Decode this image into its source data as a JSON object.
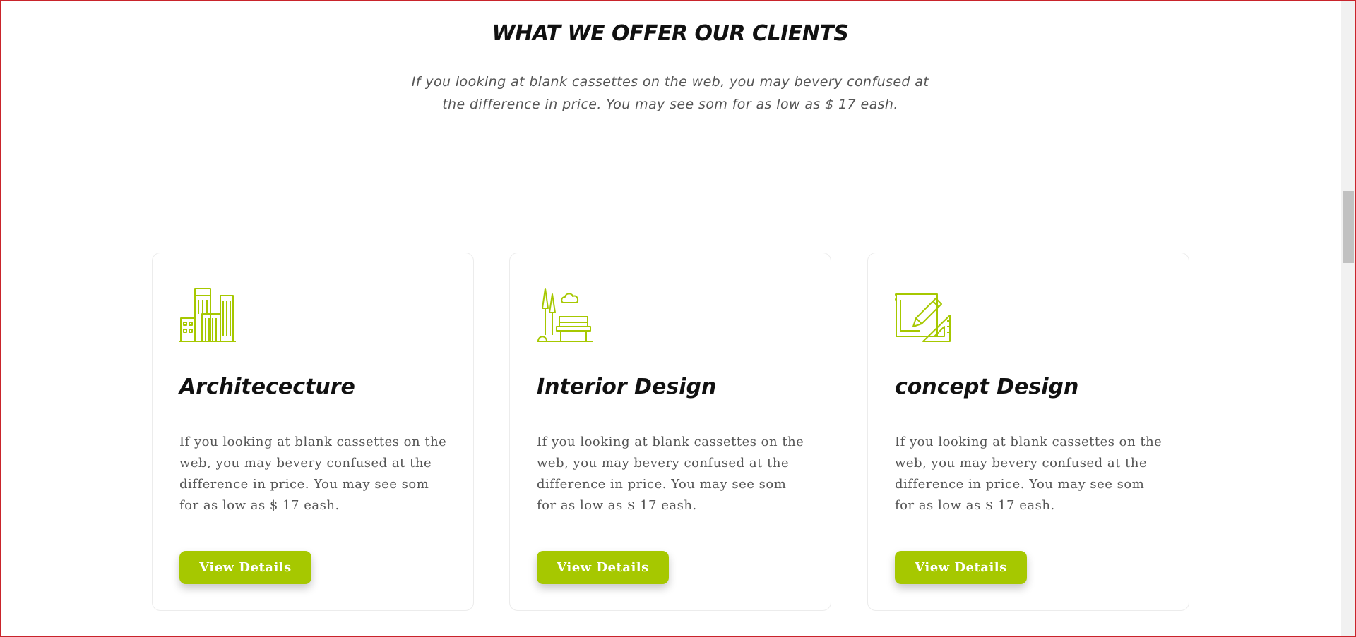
{
  "section": {
    "title": "WHAT WE OFFER OUR CLIENTS",
    "subtitle": "If you looking at blank cassettes on the web, you may bevery confused at the difference in price. You may see som for as low as $ 17 eash."
  },
  "colors": {
    "accent": "#a6c800",
    "frame": "#c9242b"
  },
  "cards": [
    {
      "icon": "city-buildings-icon",
      "title": "Architececture",
      "text": "If you looking at blank cassettes on the web, you may bevery confused at the difference in price. You may see som for as low as $ 17 eash.",
      "button": "View Details"
    },
    {
      "icon": "park-bench-icon",
      "title": "Interior Design",
      "text": "If you looking at blank cassettes on the web, you may bevery confused at the difference in price. You may see som for as low as $ 17 eash.",
      "button": "View Details"
    },
    {
      "icon": "blueprint-pencil-icon",
      "title": "concept Design",
      "text": "If you looking at blank cassettes on the web, you may bevery confused at the difference in price. You may see som for as low as $ 17 eash.",
      "button": "View Details"
    }
  ]
}
